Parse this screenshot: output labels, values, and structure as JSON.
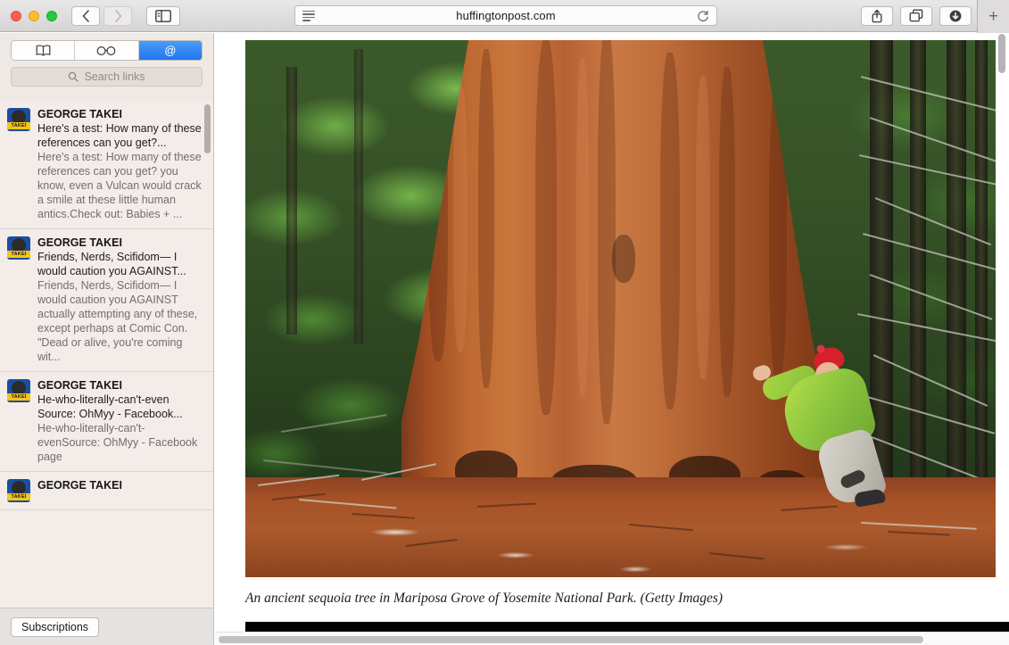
{
  "browser": {
    "url": "huffingtonpost.com",
    "traffic_lights": [
      "close",
      "minimize",
      "zoom"
    ],
    "back_label": "‹",
    "forward_label": "›",
    "new_tab_label": "+",
    "icons": {
      "sidebar": "sidebar-icon",
      "reader": "reader-view-icon",
      "reload": "reload-icon",
      "share": "share-icon",
      "tabs": "tab-overview-icon",
      "downloads": "downloads-icon"
    }
  },
  "sidebar": {
    "tabs": [
      {
        "name": "bookmarks",
        "glyph": "📖",
        "active": false
      },
      {
        "name": "reading-list",
        "glyph": "○○",
        "active": false
      },
      {
        "name": "shared-links",
        "glyph": "@",
        "active": true
      }
    ],
    "search": {
      "placeholder": "Search links"
    },
    "footer": {
      "subscriptions_label": "Subscriptions"
    },
    "links": [
      {
        "author": "GEORGE TAKEI",
        "title": "Here's a test: How many of these references can you get?...",
        "body": "Here's a test: How many of these references can you get? you know, even a Vulcan would crack a smile at these little human antics.Check out: Babies + ...",
        "avatar_label": "TAKEI"
      },
      {
        "author": "GEORGE TAKEI",
        "title": "Friends, Nerds, Scifidom— I would caution you AGAINST...",
        "body": "Friends, Nerds, Scifidom— I would caution you AGAINST actually attempting any of these, except perhaps at Comic Con. \"Dead or alive, you're coming wit...",
        "avatar_label": "TAKEI"
      },
      {
        "author": "GEORGE TAKEI",
        "title": "He-who-literally-can't-even Source: OhMyy - Facebook...",
        "body": "He-who-literally-can't-evenSource: OhMyy - Facebook page",
        "avatar_label": "TAKEI"
      },
      {
        "author": "GEORGE TAKEI",
        "title": "",
        "body": "",
        "avatar_label": "TAKEI"
      }
    ]
  },
  "content": {
    "photo_alt": "ancient-sequoia-tree-photo",
    "caption": "An ancient sequoia tree in Mariposa Grove of Yosemite National Park. (Getty Images)"
  },
  "colors": {
    "accent_blue": "#2176ef",
    "sidebar_bg": "#efe9e6",
    "trunk_brown": "#bf6a33",
    "foliage_green": "#5d9b3c",
    "jacket_green": "#8dc63f",
    "hat_red": "#d8202c",
    "ground_rust": "#a65227"
  }
}
